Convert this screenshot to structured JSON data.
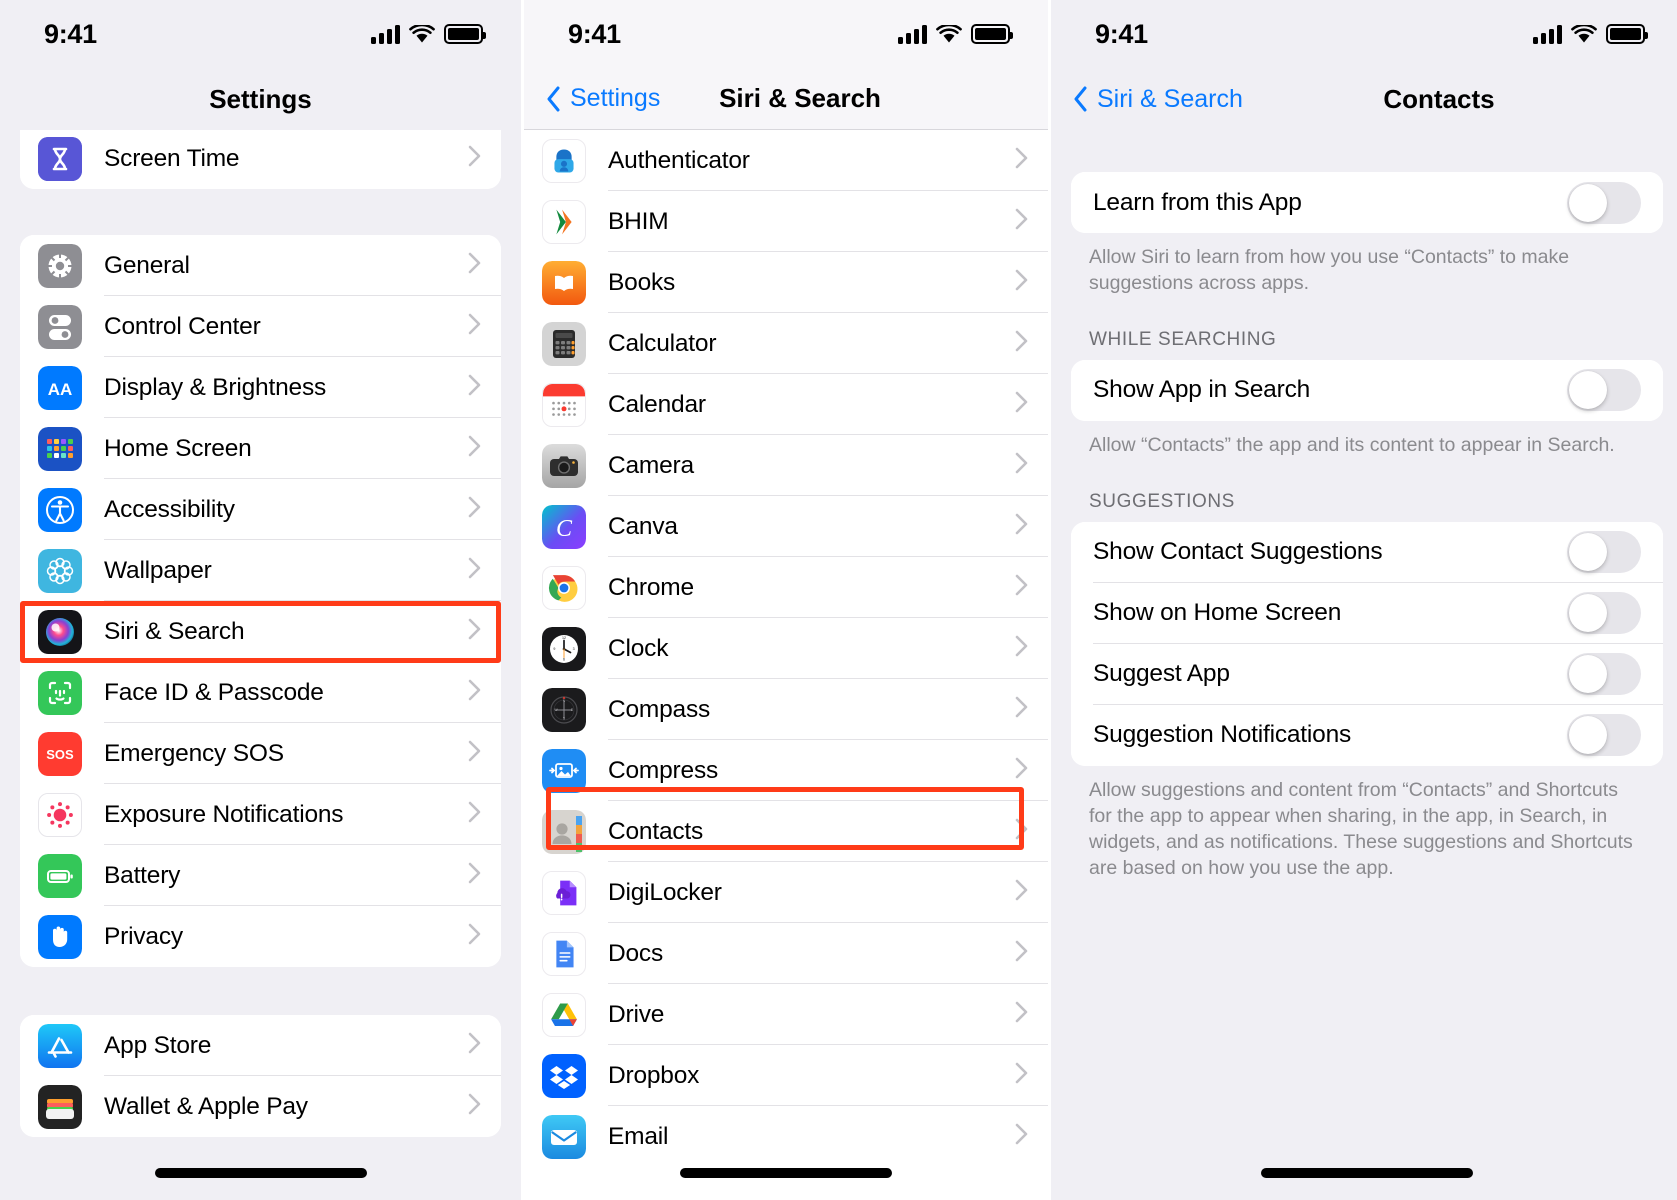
{
  "statusbar": {
    "time": "9:41",
    "signal_icon": "cellular-bars-icon",
    "wifi_icon": "wifi-icon",
    "battery_icon": "battery-icon"
  },
  "panel1": {
    "title": "Settings",
    "groups": [
      {
        "items": [
          {
            "label": "Screen Time",
            "icon": "screen-time-icon"
          }
        ]
      },
      {
        "items": [
          {
            "label": "General",
            "icon": "general-gear-icon"
          },
          {
            "label": "Control Center",
            "icon": "control-center-icon"
          },
          {
            "label": "Display & Brightness",
            "icon": "display-brightness-icon"
          },
          {
            "label": "Home Screen",
            "icon": "home-screen-icon"
          },
          {
            "label": "Accessibility",
            "icon": "accessibility-icon"
          },
          {
            "label": "Wallpaper",
            "icon": "wallpaper-icon"
          },
          {
            "label": "Siri & Search",
            "icon": "siri-search-icon",
            "highlighted": true
          },
          {
            "label": "Face ID & Passcode",
            "icon": "face-id-icon"
          },
          {
            "label": "Emergency SOS",
            "icon": "emergency-sos-icon"
          },
          {
            "label": "Exposure Notifications",
            "icon": "exposure-notifications-icon"
          },
          {
            "label": "Battery",
            "icon": "battery-settings-icon"
          },
          {
            "label": "Privacy",
            "icon": "privacy-hand-icon"
          }
        ]
      },
      {
        "items": [
          {
            "label": "App Store",
            "icon": "app-store-icon"
          },
          {
            "label": "Wallet & Apple Pay",
            "icon": "wallet-icon"
          }
        ]
      }
    ]
  },
  "panel2": {
    "back_label": "Settings",
    "title": "Siri & Search",
    "apps": [
      {
        "label": "Authenticator",
        "icon": "authenticator-icon"
      },
      {
        "label": "BHIM",
        "icon": "bhim-icon"
      },
      {
        "label": "Books",
        "icon": "books-icon"
      },
      {
        "label": "Calculator",
        "icon": "calculator-icon"
      },
      {
        "label": "Calendar",
        "icon": "calendar-icon"
      },
      {
        "label": "Camera",
        "icon": "camera-icon"
      },
      {
        "label": "Canva",
        "icon": "canva-icon"
      },
      {
        "label": "Chrome",
        "icon": "chrome-icon"
      },
      {
        "label": "Clock",
        "icon": "clock-icon"
      },
      {
        "label": "Compass",
        "icon": "compass-icon"
      },
      {
        "label": "Compress",
        "icon": "compress-icon"
      },
      {
        "label": "Contacts",
        "icon": "contacts-icon",
        "highlighted": true
      },
      {
        "label": "DigiLocker",
        "icon": "digilocker-icon"
      },
      {
        "label": "Docs",
        "icon": "docs-icon"
      },
      {
        "label": "Drive",
        "icon": "drive-icon"
      },
      {
        "label": "Dropbox",
        "icon": "dropbox-icon"
      },
      {
        "label": "Email",
        "icon": "email-icon"
      }
    ]
  },
  "panel3": {
    "back_label": "Siri & Search",
    "title": "Contacts",
    "learn": {
      "label": "Learn from this App",
      "state": "off"
    },
    "learn_footnote": "Allow Siri to learn from how you use “Contacts” to make suggestions across apps.",
    "while_searching_header": "WHILE SEARCHING",
    "show_in_search": {
      "label": "Show App in Search",
      "state": "off"
    },
    "search_footnote": "Allow “Contacts” the app and its content to appear in Search.",
    "suggestions_header": "SUGGESTIONS",
    "suggestions": [
      {
        "label": "Show Contact Suggestions",
        "state": "off"
      },
      {
        "label": "Show on Home Screen",
        "state": "off"
      },
      {
        "label": "Suggest App",
        "state": "off"
      },
      {
        "label": "Suggestion Notifications",
        "state": "off"
      }
    ],
    "suggestions_footnote": "Allow suggestions and content from “Contacts” and Shortcuts for the app to appear when sharing, in the app, in Search, in widgets, and as notifications. These suggestions and Shortcuts are based on how you use the app."
  },
  "colors": {
    "accent": "#0a7aff",
    "highlight": "#ff3b18",
    "group_bg": "#ffffff",
    "page_bg": "#f0eff4",
    "toggle_off": "#e6e5ea"
  }
}
